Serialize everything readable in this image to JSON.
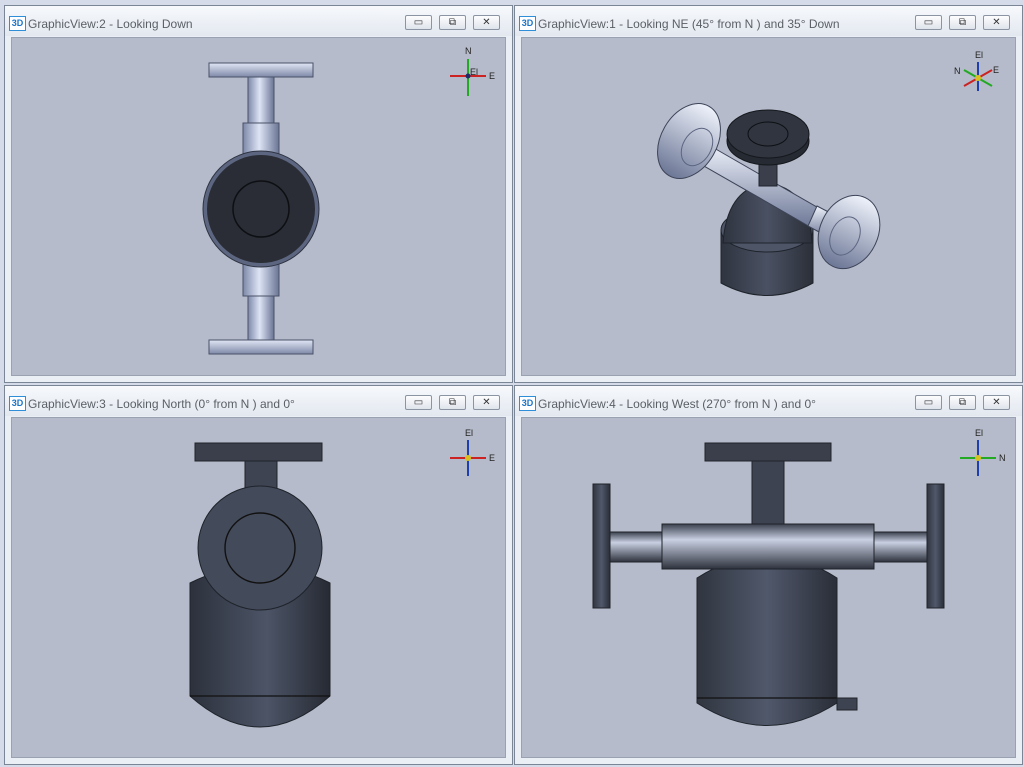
{
  "views": [
    {
      "title": "GraphicView:2 - Looking Down",
      "icon": "3D"
    },
    {
      "title": "GraphicView:1 - Looking NE (45° from N ) and 35° Down",
      "icon": "3D"
    },
    {
      "title": "GraphicView:3 - Looking North (0° from N ) and 0°",
      "icon": "3D"
    },
    {
      "title": "GraphicView:4 - Looking West (270° from N ) and 0°",
      "icon": "3D"
    }
  ],
  "window_buttons": {
    "minimize": "▭",
    "restore": "⧉",
    "close": "✕"
  },
  "triads": {
    "top": {
      "up": "N",
      "right": "E",
      "center": "El"
    },
    "ne": {
      "up": "El",
      "left": "N",
      "right": "E"
    },
    "north": {
      "up": "El",
      "right": "E"
    },
    "west": {
      "up": "El",
      "right": "N"
    }
  },
  "colors": {
    "viewport_bg": "#b5bbca",
    "metal_light": "#c3cde6",
    "metal_dark": "#3a3f4b",
    "titlebar": "#eef1f6"
  }
}
